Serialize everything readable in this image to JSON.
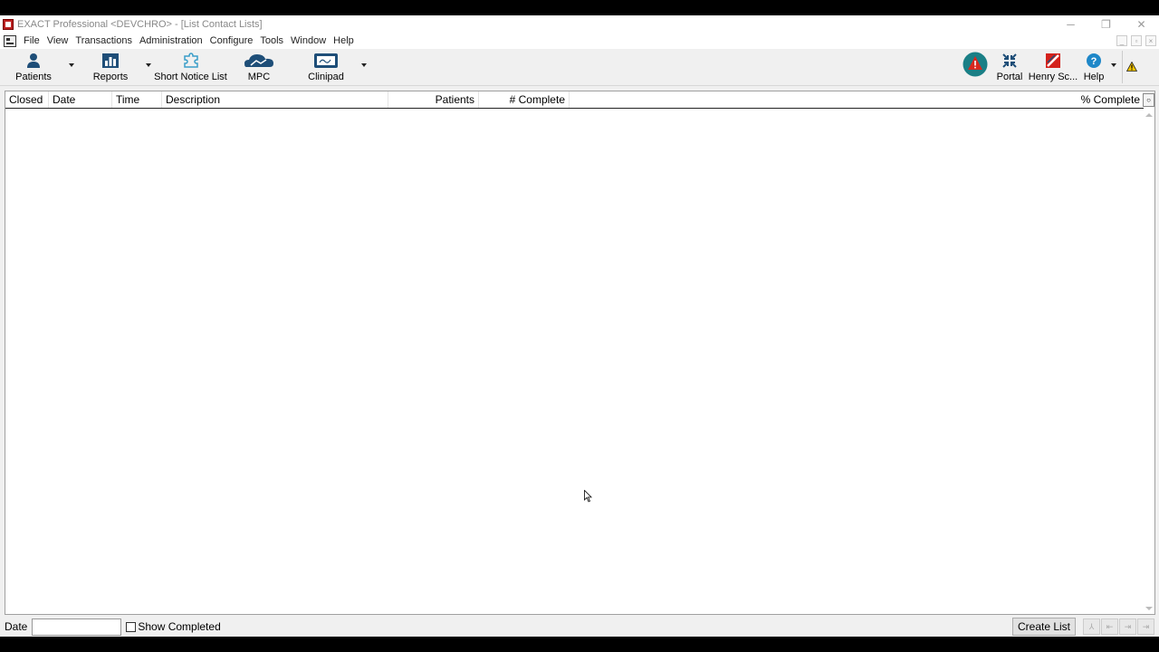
{
  "window": {
    "title": "EXACT Professional <DEVCHRO> - [List Contact Lists]",
    "controls": [
      "─",
      "❐",
      "✕"
    ]
  },
  "menu": {
    "items": [
      "File",
      "View",
      "Transactions",
      "Administration",
      "Configure",
      "Tools",
      "Window",
      "Help"
    ],
    "mdi_controls": [
      "_",
      "▫",
      "×"
    ]
  },
  "toolbar": {
    "patients": "Patients",
    "reports": "Reports",
    "short_notice_list": "Short Notice List",
    "mpc": "MPC",
    "clinipad": "Clinipad",
    "portal": "Portal",
    "henry_schein": "Henry Sc...",
    "help": "Help"
  },
  "list": {
    "columns": {
      "closed": "Closed",
      "date": "Date",
      "time": "Time",
      "description": "Description",
      "patients": "Patients",
      "num_complete": "# Complete",
      "pct_complete": "% Complete"
    },
    "rows": []
  },
  "footer": {
    "date_label": "Date",
    "date_value": "",
    "show_completed_label": "Show Completed",
    "show_completed_checked": false,
    "create_list_label": "Create List",
    "nav_buttons": [
      "⅄",
      "⇤",
      "⇥",
      "⇥"
    ]
  },
  "colors": {
    "alert_badge": "#1a7f86",
    "alert_triangle": "#d8281e",
    "toolbar_icon": "#1e4e78",
    "henry_schein_red": "#d4211b"
  },
  "icons": {
    "patients": "person-icon",
    "reports": "bar-chart-icon",
    "short_notice_list": "puzzle-icon",
    "mpc": "cloud-icon",
    "clinipad": "tablet-icon",
    "alert": "alert-icon",
    "portal": "arrows-in-icon",
    "henry_schein": "henry-schein-logo-icon",
    "help": "help-icon",
    "warning": "warning-icon"
  }
}
